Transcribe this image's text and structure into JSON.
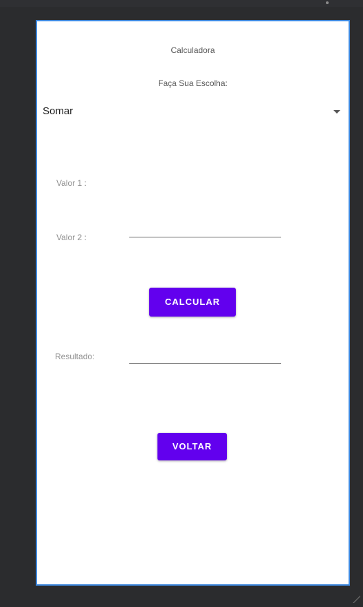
{
  "screen": {
    "title": "Calculadora",
    "subtitle": "Faça Sua Escolha:",
    "operation_select": {
      "selected": "Somar"
    },
    "fields": {
      "valor1_label": "Valor 1 :",
      "valor2_label": "Valor 2 :",
      "resultado_label": "Resultado:"
    },
    "buttons": {
      "calcular": "CALCULAR",
      "voltar": "VOLTAR"
    }
  },
  "colors": {
    "accent": "#6200ee",
    "frame_border": "#3d88de",
    "editor_background": "#2b2c2e"
  }
}
